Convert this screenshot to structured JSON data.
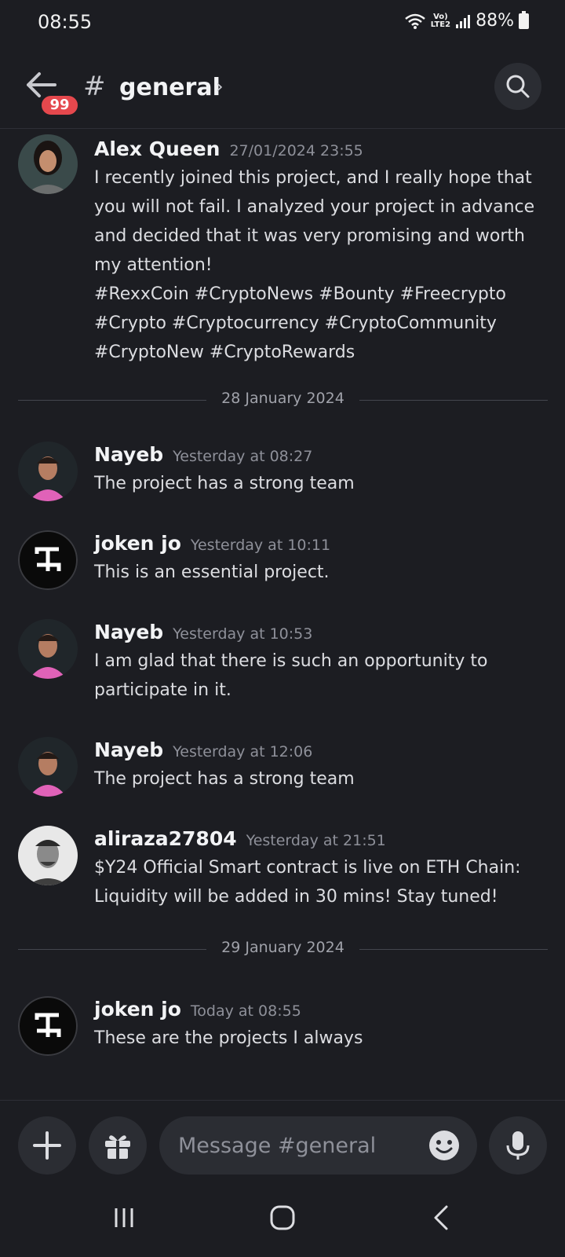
{
  "status": {
    "time": "08:55",
    "network_top": "Vo)",
    "network_bottom": "LTE2",
    "battery": "88%"
  },
  "header": {
    "unread_count": "99",
    "hash": "#",
    "channel": "general",
    "chevron": "›"
  },
  "messages": [
    {
      "author": "Alex Queen",
      "timestamp": "27/01/2024 23:55",
      "lines": [
        "I recently joined this project, and I really hope that",
        "you will not fail. I analyzed your project in advance",
        "and decided that it was very promising and worth",
        "my attention!",
        "#RexxCoin #CryptoNews #Bounty #Freecrypto",
        "#Crypto #Cryptocurrency #CryptoCommunity",
        "#CryptoNew #CryptoRewards"
      ]
    },
    {
      "author": "Nayeb",
      "timestamp": "Yesterday at 08:27",
      "lines": [
        "The project has a strong team"
      ]
    },
    {
      "author": "joken  jo",
      "timestamp": "Yesterday at 10:11",
      "lines": [
        "This is an essential project."
      ]
    },
    {
      "author": "Nayeb",
      "timestamp": "Yesterday at 10:53",
      "lines": [
        "I am glad that there is such an opportunity to",
        "participate in it."
      ]
    },
    {
      "author": "Nayeb",
      "timestamp": "Yesterday at 12:06",
      "lines": [
        "The project has a strong team"
      ]
    },
    {
      "author": "aliraza27804",
      "timestamp": "Yesterday at 21:51",
      "lines": [
        "$Y24 Official Smart contract is live on ETH Chain:",
        "Liquidity will be added in 30 mins!   Stay tuned!"
      ]
    },
    {
      "author": "joken  jo",
      "timestamp": "Today at 08:55",
      "lines": [
        "These are the projects I always"
      ]
    }
  ],
  "dividers": [
    "28 January 2024",
    "29 January 2024"
  ],
  "composer": {
    "placeholder": "Message #general"
  },
  "icons": [
    "back-arrow-icon",
    "search-icon",
    "plus-icon",
    "gift-icon",
    "emoji-icon",
    "microphone-icon",
    "recents-icon",
    "home-icon",
    "nav-back-icon"
  ],
  "colors": {
    "background": "#1c1d22",
    "badge": "#e5484d",
    "surface": "#2b2d33"
  }
}
